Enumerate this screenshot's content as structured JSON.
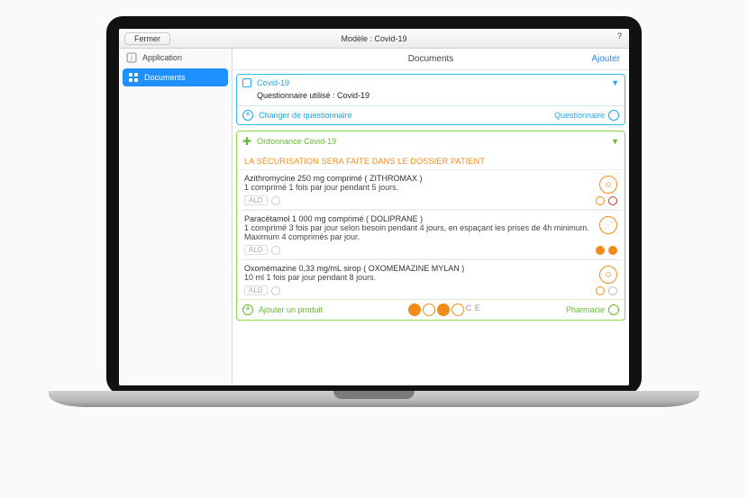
{
  "topbar": {
    "close": "Fermer",
    "title": "Modèle : Covid-19",
    "help": "?"
  },
  "sidebar": {
    "items": [
      {
        "label": "Application",
        "icon": "info-icon",
        "active": false
      },
      {
        "label": "Documents",
        "icon": "grid-icon",
        "active": true
      }
    ]
  },
  "main": {
    "title": "Documents",
    "add": "Ajouter"
  },
  "quest_card": {
    "title": "Covid-19",
    "subtitle": "Questionnaire utilisé : Covid-19",
    "change": "Changer de questionnaire",
    "right": "Questionnaire"
  },
  "ord_card": {
    "title": "Ordonnance Covid-19",
    "warning": "LA SÉCURISATION SERA FAITE DANS LE DOSSIER PATIENT",
    "ald": "ALD",
    "add_prod": "Ajouter un produit",
    "pharm": "Pharmacie",
    "ce": "C E",
    "meds": [
      {
        "name": "Azithromycine 250 mg comprimé ( ZITHROMAX )",
        "dose": "1 comprimé 1 fois par jour pendant 5 jours."
      },
      {
        "name": "Paracétamol 1 000 mg comprimé ( DOLIPRANE )",
        "dose": "1 comprimé 3 fois par jour selon besoin pendant 4 jours, en espaçant les prises de 4h minimum. Maximum 4 comprimés par jour."
      },
      {
        "name": "Oxomémazine 0,33 mg/mL sirop ( OXOMEMAZINE MYLAN )",
        "dose": "10 ml 1 fois par jour pendant 8 jours."
      }
    ]
  }
}
